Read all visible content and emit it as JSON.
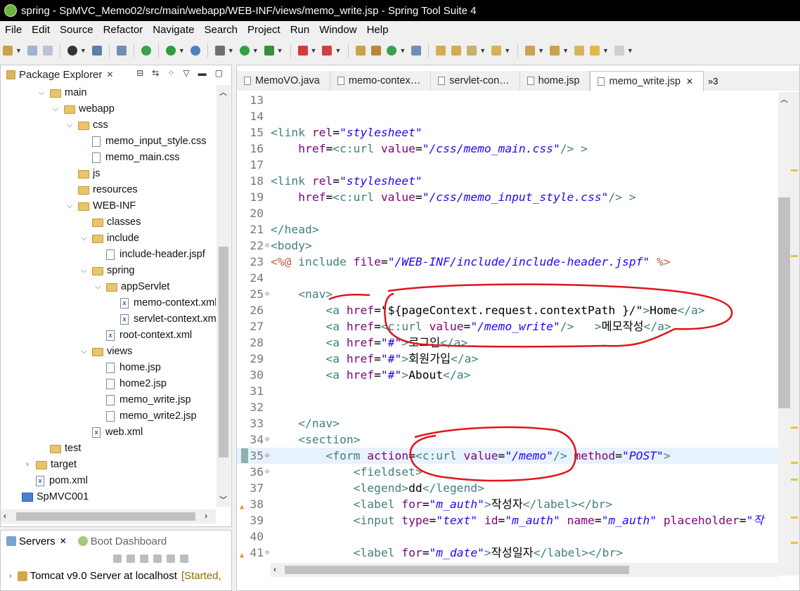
{
  "window": {
    "title": "spring - SpMVC_Memo02/src/main/webapp/WEB-INF/views/memo_write.jsp - Spring Tool Suite 4"
  },
  "menu": [
    "File",
    "Edit",
    "Source",
    "Refactor",
    "Navigate",
    "Search",
    "Project",
    "Run",
    "Window",
    "Help"
  ],
  "package_explorer": {
    "title": "Package Explorer",
    "items": [
      {
        "label": "main",
        "depth": 3,
        "type": "folder-src",
        "twist": "open"
      },
      {
        "label": "webapp",
        "depth": 4,
        "type": "folder-src",
        "twist": "open"
      },
      {
        "label": "css",
        "depth": 5,
        "type": "folder",
        "twist": "open"
      },
      {
        "label": "memo_input_style.css",
        "depth": 6,
        "type": "file",
        "twist": ""
      },
      {
        "label": "memo_main.css",
        "depth": 6,
        "type": "file",
        "twist": ""
      },
      {
        "label": "js",
        "depth": 5,
        "type": "folder",
        "twist": ""
      },
      {
        "label": "resources",
        "depth": 5,
        "type": "folder",
        "twist": ""
      },
      {
        "label": "WEB-INF",
        "depth": 5,
        "type": "folder-src",
        "twist": "open"
      },
      {
        "label": "classes",
        "depth": 6,
        "type": "folder",
        "twist": ""
      },
      {
        "label": "include",
        "depth": 6,
        "type": "folder",
        "twist": "open"
      },
      {
        "label": "include-header.jspf",
        "depth": 7,
        "type": "file",
        "twist": ""
      },
      {
        "label": "spring",
        "depth": 6,
        "type": "folder-src",
        "twist": "open"
      },
      {
        "label": "appServlet",
        "depth": 7,
        "type": "folder-src",
        "twist": "open"
      },
      {
        "label": "memo-context.xml",
        "depth": 8,
        "type": "xml",
        "twist": ""
      },
      {
        "label": "servlet-context.xml",
        "depth": 8,
        "type": "xml",
        "twist": ""
      },
      {
        "label": "root-context.xml",
        "depth": 7,
        "type": "xml",
        "twist": ""
      },
      {
        "label": "views",
        "depth": 6,
        "type": "folder",
        "twist": "open"
      },
      {
        "label": "home.jsp",
        "depth": 7,
        "type": "file",
        "twist": ""
      },
      {
        "label": "home2.jsp",
        "depth": 7,
        "type": "file",
        "twist": ""
      },
      {
        "label": "memo_write.jsp",
        "depth": 7,
        "type": "file",
        "twist": ""
      },
      {
        "label": "memo_write2.jsp",
        "depth": 7,
        "type": "file",
        "twist": ""
      },
      {
        "label": "web.xml",
        "depth": 6,
        "type": "xml",
        "twist": ""
      },
      {
        "label": "test",
        "depth": 3,
        "type": "folder",
        "twist": ""
      },
      {
        "label": "target",
        "depth": 2,
        "type": "folder",
        "twist": "closed"
      },
      {
        "label": "pom.xml",
        "depth": 2,
        "type": "xml",
        "twist": ""
      },
      {
        "label": "SpMVC001",
        "depth": 1,
        "type": "project",
        "twist": ""
      }
    ]
  },
  "servers": {
    "tab_servers": "Servers",
    "tab_boot": "Boot Dashboard",
    "server_name": "Tomcat v9.0 Server at localhost",
    "server_status": "[Started,"
  },
  "editor": {
    "tabs": [
      {
        "label": "MemoVO.java",
        "active": false
      },
      {
        "label": "memo-contex…",
        "active": false
      },
      {
        "label": "servlet-con…",
        "active": false
      },
      {
        "label": "home.jsp",
        "active": false
      },
      {
        "label": "memo_write.jsp",
        "active": true
      }
    ],
    "overflow_label": "»3",
    "current_line": 35,
    "lines": [
      {
        "n": "13",
        "fold": "",
        "html": ""
      },
      {
        "n": "14",
        "fold": "",
        "html": ""
      },
      {
        "n": "15",
        "fold": "",
        "html": "<span class='tag'>&lt;link </span><span class='attr'>rel</span>=<span class='val'>\"stylesheet\"</span>"
      },
      {
        "n": "16",
        "fold": "",
        "html": "    <span class='attr'>href</span>=<span class='tag'>&lt;c:url </span><span class='attr'>value</span>=<span class='val'>\"/css/memo_main.css\"</span><span class='tag'>/&gt;</span> <span class='tag'>&gt;</span>"
      },
      {
        "n": "17",
        "fold": "",
        "html": ""
      },
      {
        "n": "18",
        "fold": "",
        "html": "<span class='tag'>&lt;link </span><span class='attr'>rel</span>=<span class='val'>\"stylesheet\"</span>"
      },
      {
        "n": "19",
        "fold": "",
        "html": "    <span class='attr'>href</span>=<span class='tag'>&lt;c:url </span><span class='attr'>value</span>=<span class='val'>\"/css/memo_input_style.css\"</span><span class='tag'>/&gt;</span> <span class='tag'>&gt;</span>"
      },
      {
        "n": "20",
        "fold": "",
        "html": ""
      },
      {
        "n": "21",
        "fold": "",
        "html": "<span class='tag'>&lt;/head&gt;</span>"
      },
      {
        "n": "22",
        "fold": "⊖",
        "html": "<span class='tag'>&lt;body&gt;</span>"
      },
      {
        "n": "23",
        "fold": "",
        "html": "<span class='dir'>&lt;%@</span> <span class='tag'>include </span><span class='attr'>file</span>=<span class='val'>\"/WEB-INF/include/include-header.jspf\"</span> <span class='dir'>%&gt;</span>"
      },
      {
        "n": "24",
        "fold": "",
        "html": ""
      },
      {
        "n": "25",
        "fold": "⊖",
        "html": "    <span class='tag'>&lt;nav&gt;</span>"
      },
      {
        "n": "26",
        "fold": "",
        "html": "        <span class='tag'>&lt;a </span><span class='attr'>href</span>=<span class='txt'>\"${pageContext.request.contextPath }/\"</span><span class='tag'>&gt;</span><span class='txt'>Home</span><span class='tag'>&lt;/a&gt;</span>"
      },
      {
        "n": "27",
        "fold": "",
        "html": "        <span class='tag'>&lt;a </span><span class='attr'>href</span>=<span class='tag'>&lt;c:url </span><span class='attr'>value</span>=<span class='val'>\"/memo_write\"</span><span class='tag'>/&gt;</span>   <span class='tag'>&gt;</span><span class='txt'>메모작성</span><span class='tag'>&lt;/a&gt;</span>"
      },
      {
        "n": "28",
        "fold": "",
        "html": "        <span class='tag'>&lt;a </span><span class='attr'>href</span>=<span class='val'>\"#\"</span><span class='tag'>&gt;</span><span class='txt'>로그인</span><span class='tag'>&lt;/a&gt;</span>"
      },
      {
        "n": "29",
        "fold": "",
        "html": "        <span class='tag'>&lt;a </span><span class='attr'>href</span>=<span class='val'>\"#\"</span><span class='tag'>&gt;</span><span class='txt'>회원가입</span><span class='tag'>&lt;/a&gt;</span>"
      },
      {
        "n": "30",
        "fold": "",
        "html": "        <span class='tag'>&lt;a </span><span class='attr'>href</span>=<span class='val'>\"#\"</span><span class='tag'>&gt;</span><span class='txt'>About</span><span class='tag'>&lt;/a&gt;</span>"
      },
      {
        "n": "31",
        "fold": "",
        "html": ""
      },
      {
        "n": "32",
        "fold": "",
        "html": ""
      },
      {
        "n": "33",
        "fold": "",
        "html": "    <span class='tag'>&lt;/nav&gt;</span>"
      },
      {
        "n": "34",
        "fold": "⊖",
        "html": "    <span class='tag'>&lt;section&gt;</span>"
      },
      {
        "n": "35",
        "fold": "⊖",
        "html": "        <span class='tag'>&lt;form </span><span class='attr'>action</span>=<span class='tag'>&lt;c:url </span><span class='attr'>value</span>=<span class='val'>\"/memo\"</span><span class='tag'>/&gt;</span> <span class='attr'>method</span>=<span class='val'>\"POST\"</span><span class='tag'>&gt;</span>"
      },
      {
        "n": "36",
        "fold": "⊖",
        "html": "            <span class='tag'>&lt;fieldset&gt;</span>"
      },
      {
        "n": "37",
        "fold": "",
        "html": "            <span class='tag'>&lt;legend&gt;</span><span class='txt'>dd</span><span class='tag'>&lt;/legend&gt;</span>"
      },
      {
        "n": "38",
        "fold": "",
        "html": "            <span class='tag'>&lt;label </span><span class='attr'>for</span>=<span class='val'>\"m_auth\"</span><span class='tag'>&gt;</span><span class='txt'>작성자</span><span class='tag'>&lt;/label&gt;&lt;/br&gt;</span>"
      },
      {
        "n": "39",
        "fold": "",
        "html": "            <span class='tag'>&lt;input </span><span class='attr'>type</span>=<span class='val'>\"text\"</span> <span class='attr'>id</span>=<span class='val'>\"m_auth\"</span> <span class='attr'>name</span>=<span class='val'>\"m_auth\"</span> <span class='attr'>placeholder</span>=<span class='val'>\"작</span>"
      },
      {
        "n": "40",
        "fold": "",
        "html": ""
      },
      {
        "n": "41",
        "fold": "⊖",
        "html": "            <span class='tag'>&lt;label </span><span class='attr'>for</span>=<span class='val'>\"m_date\"</span><span class='tag'>&gt;</span><span class='txt'>작성일자</span><span class='tag'>&lt;/label&gt;&lt;/br&gt;</span>"
      }
    ]
  }
}
